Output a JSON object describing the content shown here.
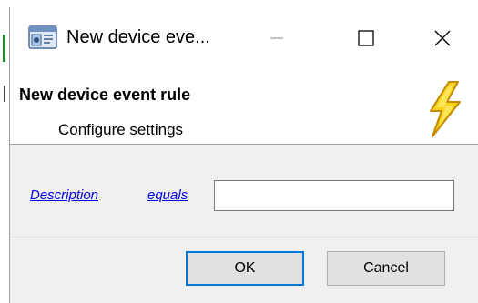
{
  "window": {
    "title": "New device eve...",
    "minimize_icon": "minimize-icon",
    "maximize_icon": "maximize-icon",
    "close_icon": "close-icon",
    "app_icon": "device-event-app-icon"
  },
  "header": {
    "title": "New device event rule",
    "subtitle": "Configure settings",
    "icon": "lightning-bolt-icon"
  },
  "rule": {
    "field_link": "Description",
    "operator_link": "equals",
    "value": "",
    "placeholder": ""
  },
  "buttons": {
    "ok_label": "OK",
    "cancel_label": "Cancel"
  },
  "colors": {
    "link": "#0000ee",
    "default_button_border": "#0078d7",
    "bolt_fill": "#f7d21b",
    "bolt_outline": "#c18a00"
  }
}
